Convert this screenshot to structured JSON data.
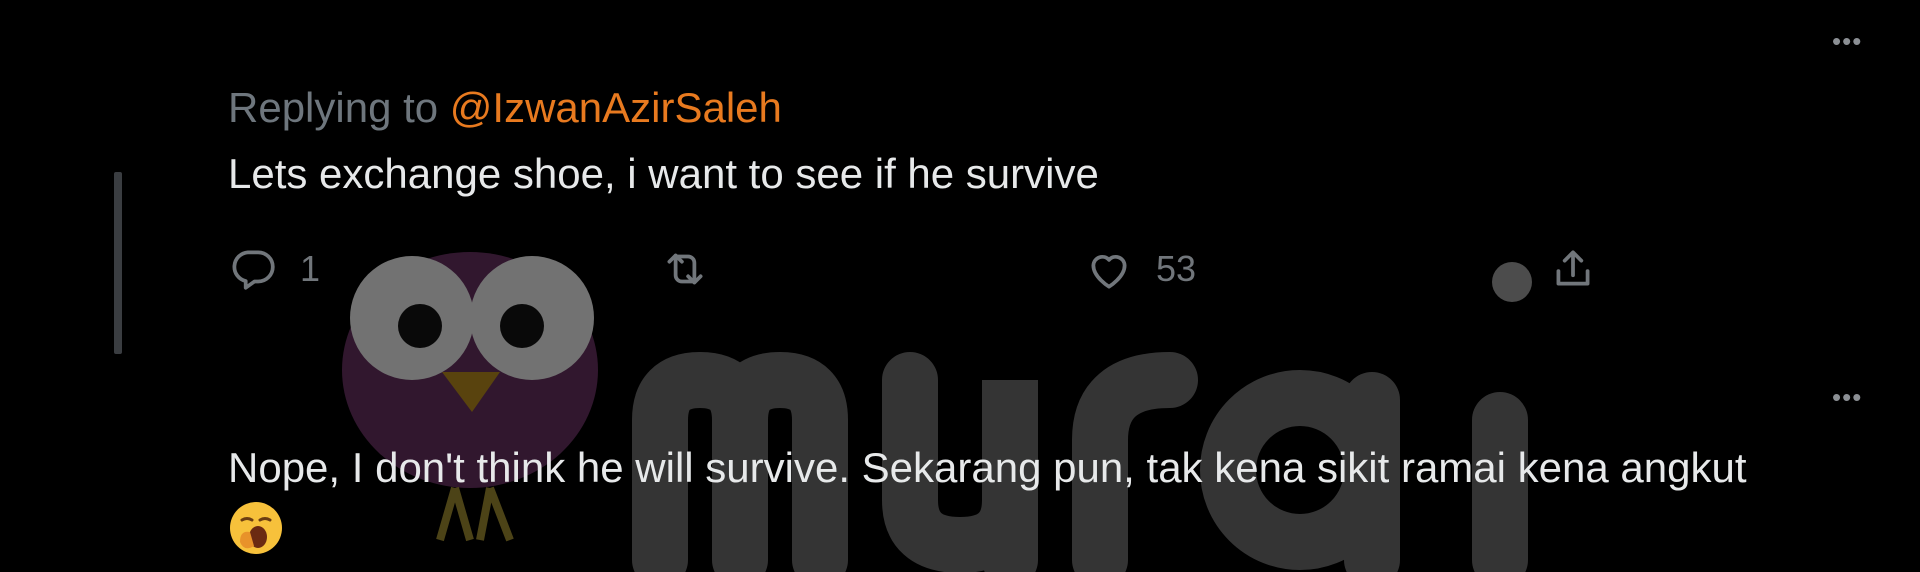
{
  "watermark": {
    "text": "murai"
  },
  "tweet1": {
    "more_label": "•••",
    "replying_prefix": "Replying to",
    "replying_handle": "@IzwanAzirSaleh",
    "text": "Lets exchange shoe, i want to see if he survive",
    "actions": {
      "reply_count": "1",
      "retweet_count": "",
      "like_count": "53"
    }
  },
  "tweet2": {
    "more_label": "•••",
    "text": "Nope, I don't think he will survive. Sekarang pun, tak kena sikit ramai kena angkut",
    "emoji": "yawning-face"
  },
  "colors": {
    "background": "#000000",
    "text": "#e7e9ea",
    "muted": "#6e767d",
    "handle": "#e87a1f"
  }
}
